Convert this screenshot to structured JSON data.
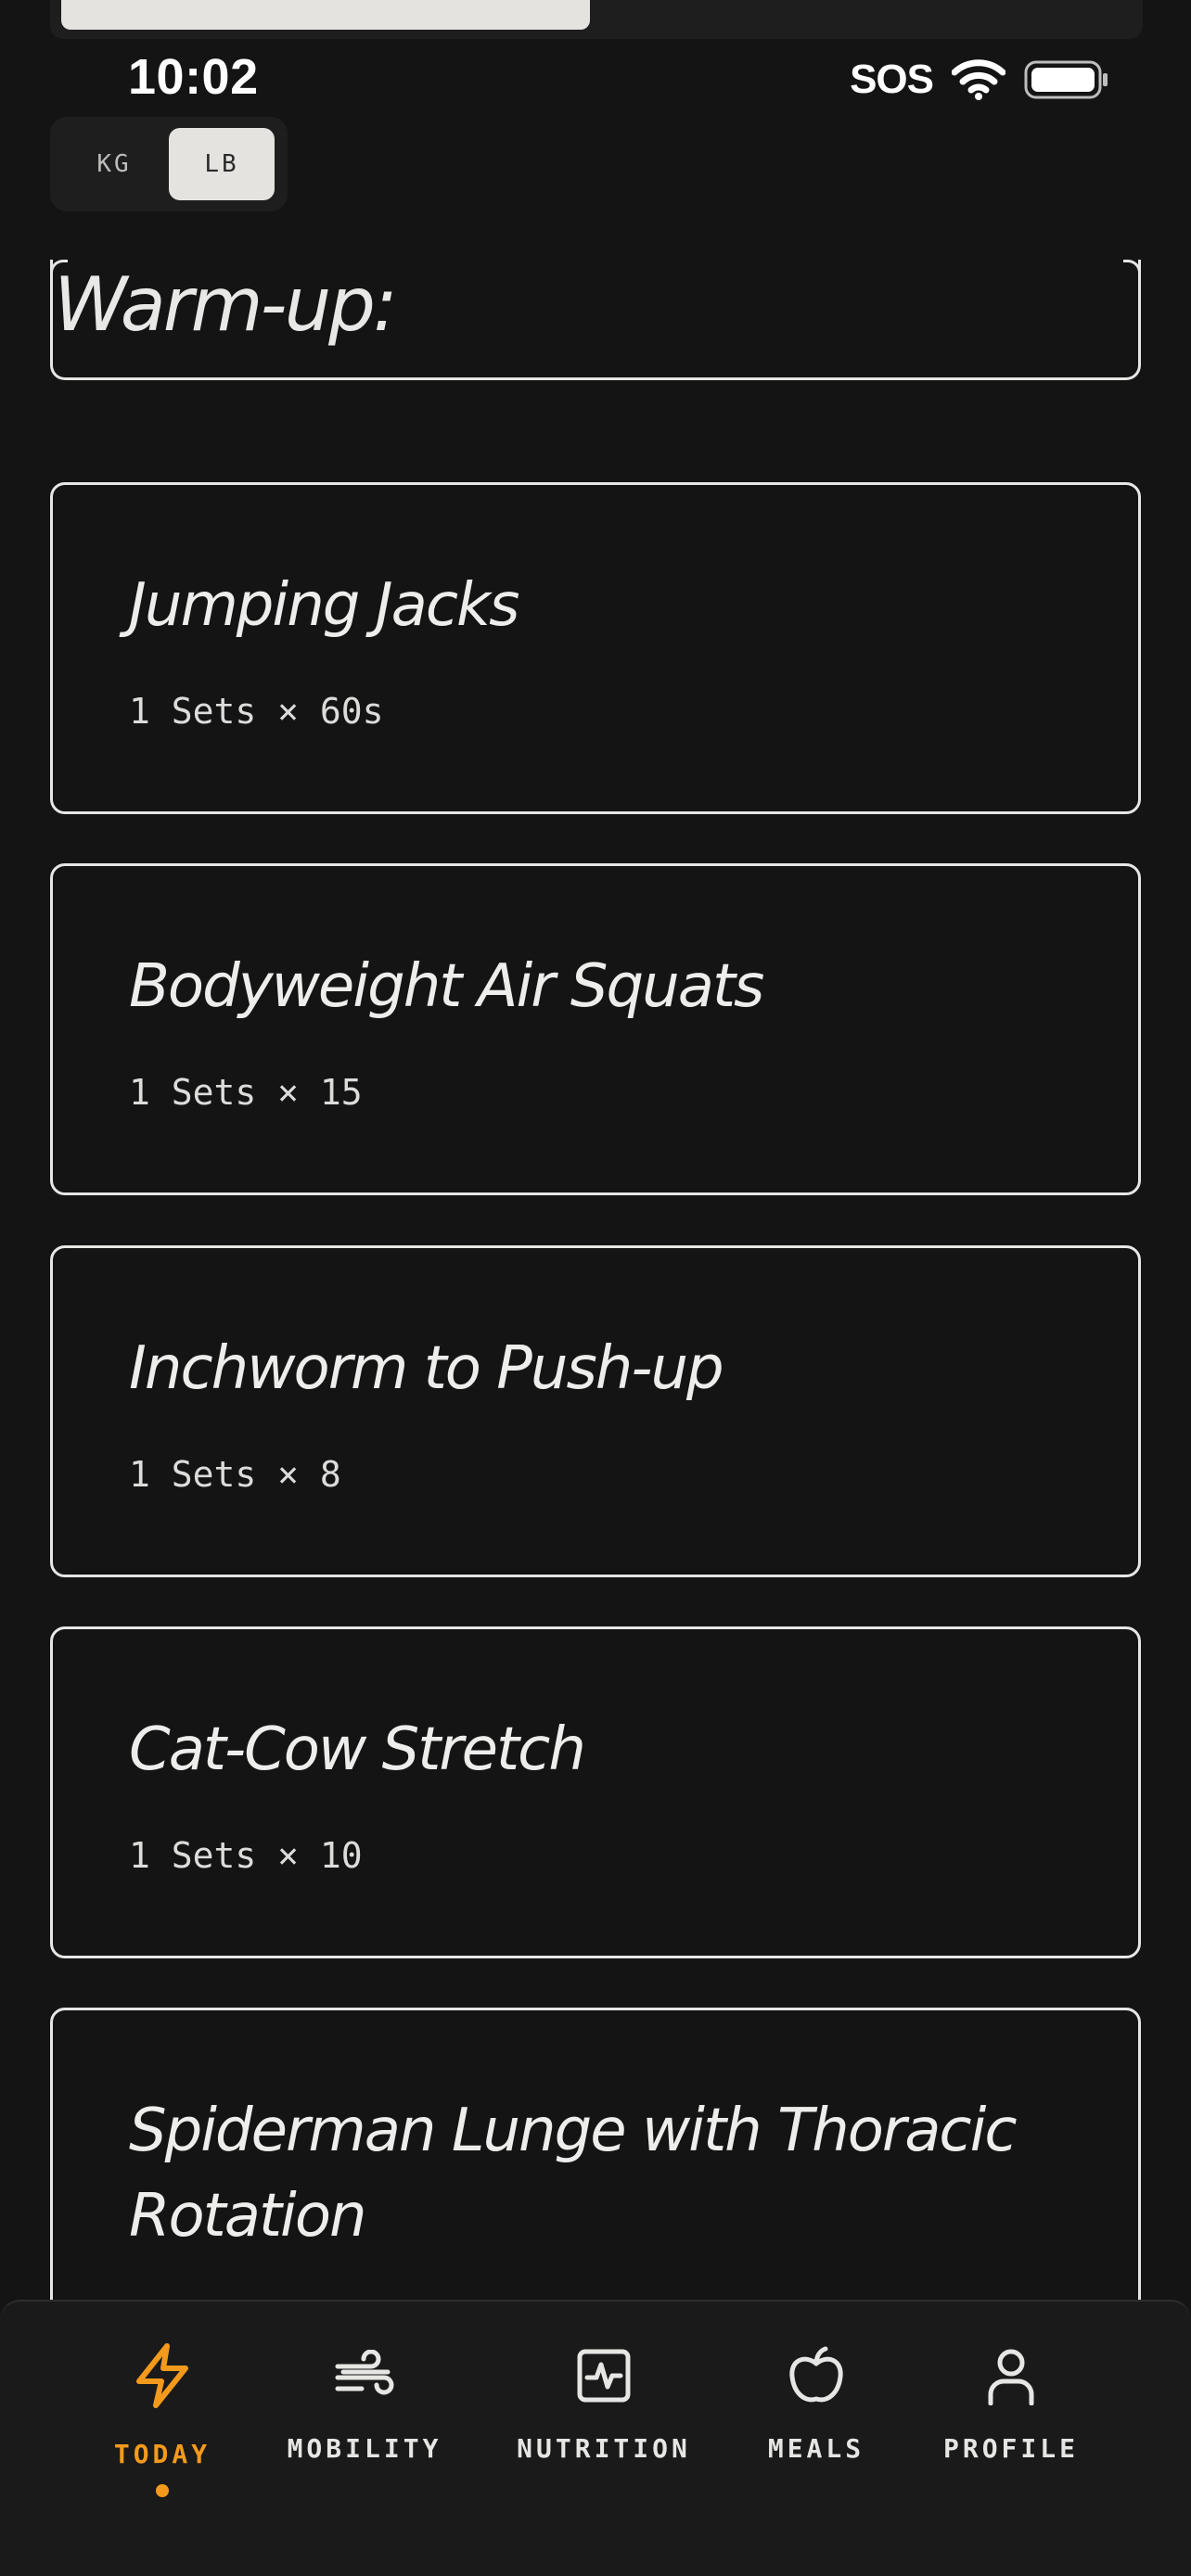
{
  "status_bar": {
    "time": "10:02",
    "sos": "SOS"
  },
  "unit_toggle": {
    "options": [
      "KG",
      "LB"
    ],
    "selected": "LB"
  },
  "section": {
    "title": "Warm-up:"
  },
  "exercises": [
    {
      "name": "Jumping Jacks",
      "detail": "1 Sets × 60s"
    },
    {
      "name": "Bodyweight Air Squats",
      "detail": "1 Sets × 15"
    },
    {
      "name": "Inchworm to Push-up",
      "detail": "1 Sets × 8"
    },
    {
      "name": "Cat-Cow Stretch",
      "detail": "1 Sets × 10"
    },
    {
      "name": "Spiderman Lunge with Thoracic Rotation",
      "detail": ""
    }
  ],
  "tab_bar": {
    "items": [
      {
        "label": "TODAY",
        "icon": "lightning-bolt-icon",
        "active": true
      },
      {
        "label": "MOBILITY",
        "icon": "wind-icon",
        "active": false
      },
      {
        "label": "NUTRITION",
        "icon": "activity-square-icon",
        "active": false
      },
      {
        "label": "MEALS",
        "icon": "apple-icon",
        "active": false
      },
      {
        "label": "PROFILE",
        "icon": "person-icon",
        "active": false
      }
    ],
    "active_color": "#F39A1C",
    "inactive_color": "#E6E6E4"
  }
}
